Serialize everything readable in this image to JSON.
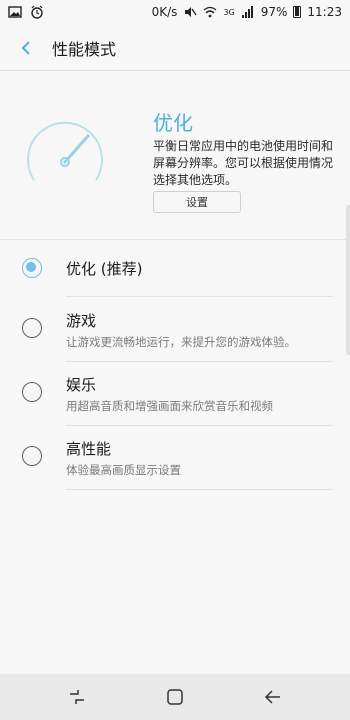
{
  "status_bar": {
    "network_speed": "0K/s",
    "network_type": "3G",
    "battery": "97%",
    "time": "11:23"
  },
  "header": {
    "title": "性能模式",
    "back_icon": "back-arrow-icon"
  },
  "current_mode": {
    "title": "优化",
    "description": "平衡日常应用中的电池使用时间和屏幕分辨率。您可以根据使用情况选择其他选项。",
    "settings_label": "设置",
    "icon": "speedometer-icon"
  },
  "options": [
    {
      "title": "优化 (推荐)",
      "subtitle": "",
      "selected": true
    },
    {
      "title": "游戏",
      "subtitle": "让游戏更流畅地运行，来提升您的游戏体验。",
      "selected": false
    },
    {
      "title": "娱乐",
      "subtitle": "用超高音质和增强画面来欣赏音乐和视频",
      "selected": false
    },
    {
      "title": "高性能",
      "subtitle": "体验最高画质显示设置",
      "selected": false
    }
  ],
  "colors": {
    "accent": "#4fb0de",
    "radio_on": "#6fc0ea",
    "background": "#f7f7f7"
  },
  "nav_bar": {
    "recent_icon": "recents-icon",
    "home_icon": "home-icon",
    "back_icon": "back-icon"
  }
}
